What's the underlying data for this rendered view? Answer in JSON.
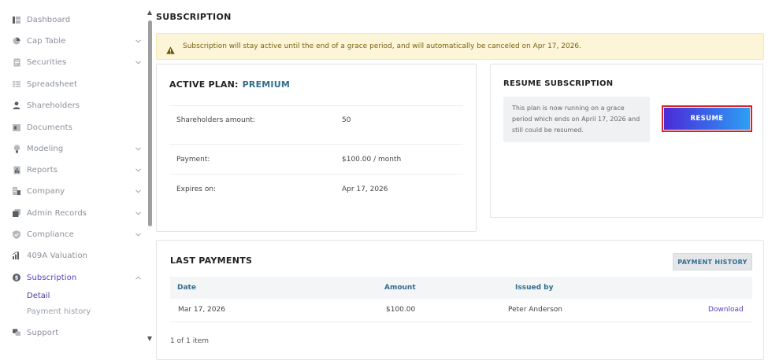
{
  "sidebar": {
    "items": [
      {
        "label": "Dashboard",
        "icon": "dashboard-icon"
      },
      {
        "label": "Cap Table",
        "icon": "pie-chart-icon"
      },
      {
        "label": "Securities",
        "icon": "document-icon"
      },
      {
        "label": "Spreadsheet",
        "icon": "spreadsheet-icon"
      },
      {
        "label": "Shareholders",
        "icon": "user-icon"
      },
      {
        "label": "Documents",
        "icon": "folder-icon"
      },
      {
        "label": "Modeling",
        "icon": "lightbulb-icon"
      },
      {
        "label": "Reports",
        "icon": "report-icon"
      },
      {
        "label": "Company",
        "icon": "building-icon"
      },
      {
        "label": "Admin Records",
        "icon": "records-icon"
      },
      {
        "label": "Compliance",
        "icon": "shield-check-icon"
      },
      {
        "label": "409A Valuation",
        "icon": "bar-chart-icon"
      },
      {
        "label": "Subscription",
        "icon": "dollar-circle-icon"
      },
      {
        "label": "Support",
        "icon": "support-icon"
      }
    ],
    "sub_items": {
      "detail": "Detail",
      "payment_history": "Payment history"
    }
  },
  "page": {
    "title": "SUBSCRIPTION"
  },
  "alert": {
    "icon": "warning-icon",
    "text": "Subscription will stay active until the end of a grace period, and will automatically be canceled on Apr 17, 2026."
  },
  "plan": {
    "title": "ACTIVE PLAN:",
    "name": "PREMIUM",
    "rows": [
      {
        "label": "Shareholders amount:",
        "value": "50"
      },
      {
        "label": "Payment:",
        "value": "$100.00 / month"
      },
      {
        "label": "Expires on:",
        "value": "Apr 17, 2026"
      }
    ]
  },
  "resume": {
    "title": "RESUME SUBSCRIPTION",
    "info": "This plan is now running on a grace period which ends on April 17, 2026 and still could be resumed.",
    "button": "RESUME"
  },
  "payments": {
    "title": "LAST PAYMENTS",
    "history_button": "PAYMENT HISTORY",
    "columns": [
      "Date",
      "Amount",
      "Issued by"
    ],
    "rows": [
      {
        "date": "Mar 17, 2026",
        "amount": "$100.00",
        "issued_by": "Peter Anderson",
        "action": "Download"
      }
    ],
    "pager": "1 of 1 item"
  },
  "colors": {
    "accent": "#2f6e8e",
    "active_nav": "#5b3fc0",
    "alert_bg": "#fdf5d7",
    "resume_gradient_start": "#4b2bd6",
    "resume_gradient_end": "#2da0f2",
    "highlight_border": "#d2252e"
  }
}
